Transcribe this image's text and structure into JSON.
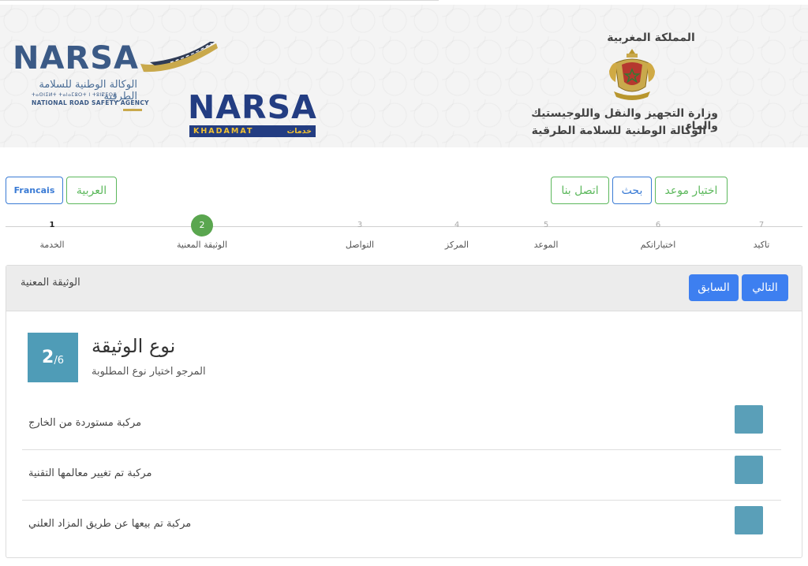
{
  "header": {
    "narsa_logo": {
      "brand": "NARSA",
      "arabic_name": "الوكالة الوطنية للسلامة الطرقية",
      "tifinagh": "ⵜⴰⵙⵏⵉⵍⵜ ⵜⴰⵏⴰⵎⵓⵔⵜ ⵏ ⵜⵓⵏⵇⵉⵙⵜ",
      "english_name": "NATIONAL ROAD SAFETY AGENCY"
    },
    "khadamat_logo": {
      "brand": "NARSA",
      "latin": "KHADAMAT",
      "arabic": "خدمات"
    },
    "ministry": {
      "kingdom": "المملكة المغربية",
      "line1": "وزارة التجهيز والنقل واللوجيستيك والماء",
      "line2": "الوكالة الوطنية للسلامة الطرقية"
    }
  },
  "nav": {
    "lang_fr": "Francais",
    "lang_ar": "العربية",
    "contact": "اتصل بنا",
    "search": "بحث",
    "appointment": "اختيار موعد"
  },
  "stepper": {
    "steps": [
      {
        "num": "1",
        "label": "الخدمة"
      },
      {
        "num": "2",
        "label": "الوثيقة المعنية"
      },
      {
        "num": "3",
        "label": "التواصل"
      },
      {
        "num": "4",
        "label": "المركز"
      },
      {
        "num": "5",
        "label": "الموعد"
      },
      {
        "num": "6",
        "label": "اختياراتكم"
      },
      {
        "num": "7",
        "label": "تاكيد"
      }
    ],
    "current": 2
  },
  "panel": {
    "title": "الوثيقة المعنية",
    "prev_label": "السابق",
    "next_label": "التالي",
    "badge_current": "2",
    "badge_total": "/6",
    "heading": "نوع الوثيقة",
    "subheading": "المرجو اختيار نوع المطلوبة",
    "options": [
      "مركبة مستوردة من الخارج",
      "مركبة تم تغيير معالمها التقنية",
      "مركبة تم بيعها عن طريق المزاد العلني"
    ]
  },
  "colors": {
    "green": "#5cb85c",
    "blue": "#3d7ff0",
    "teal": "#4f9cb7",
    "step_active": "#5aa64f",
    "narsa_blue": "#3b5a86",
    "khadamat_navy": "#233d82",
    "khadamat_yellow": "#f2c232"
  }
}
